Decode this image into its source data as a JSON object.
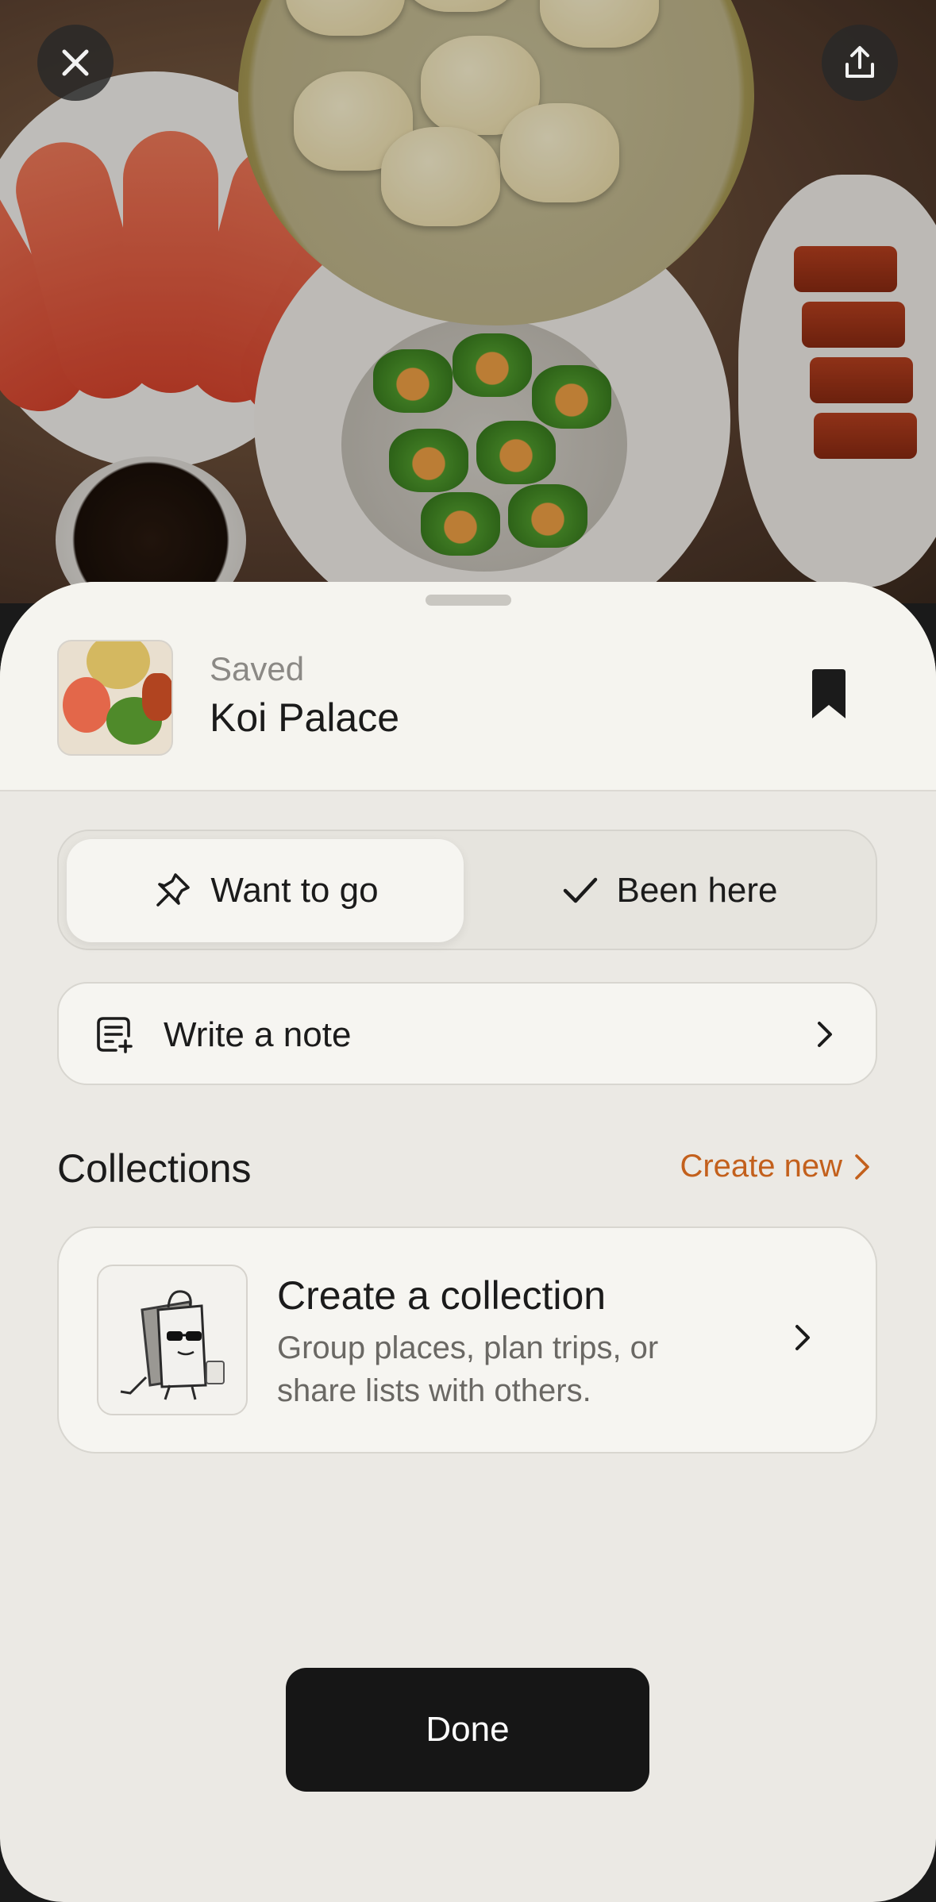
{
  "header": {
    "status_label": "Saved",
    "place_name": "Koi Palace"
  },
  "segment": {
    "want_to_go": "Want to go",
    "been_here": "Been here",
    "selected": "Want to go"
  },
  "note": {
    "label": "Write a note"
  },
  "collections": {
    "title": "Collections",
    "create_new": "Create new",
    "card": {
      "title": "Create a collection",
      "description": "Group places, plan trips, or share lists with others."
    }
  },
  "done_label": "Done",
  "colors": {
    "accent": "#c3601c",
    "sheet_background": "#ebe9e4",
    "primary_button": "#161616"
  },
  "icons": {
    "close": "close-icon",
    "share": "share-icon",
    "bookmark": "bookmark-icon",
    "pin": "pin-icon",
    "check": "check-icon",
    "note": "note-add-icon",
    "chevron": "chevron-right-icon"
  }
}
